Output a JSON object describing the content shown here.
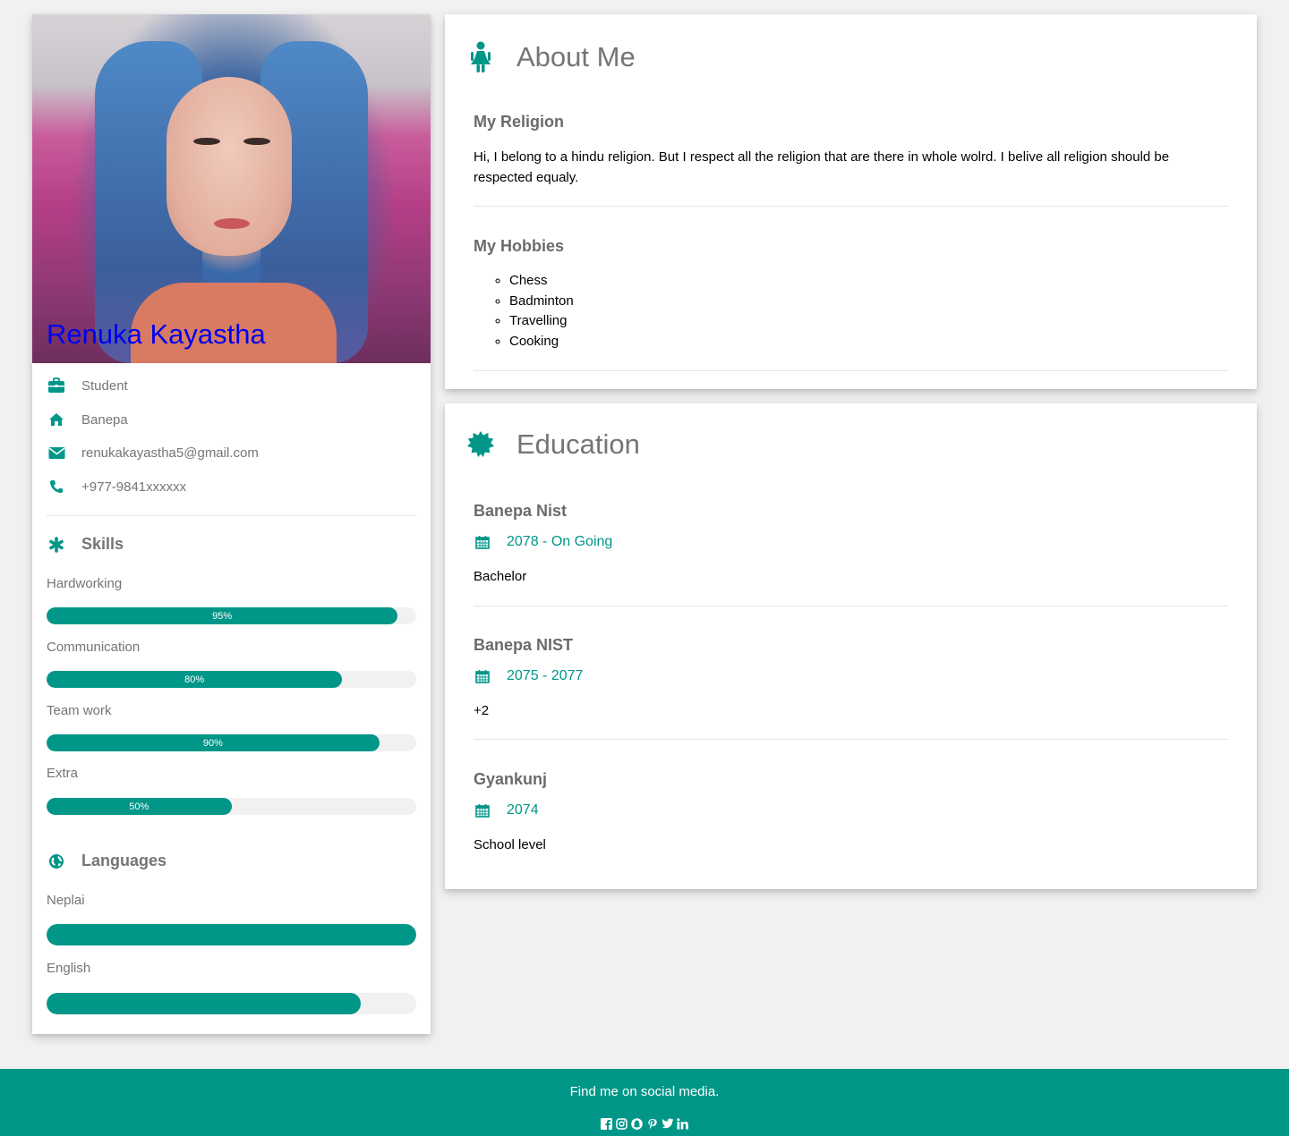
{
  "profile": {
    "name": "Renuka Kayastha",
    "job": "Student",
    "location": "Banepa",
    "email": "renukakayastha5@gmail.com",
    "phone": "+977-9841xxxxxx",
    "accent_color": "#009688",
    "name_color": "#0000ee"
  },
  "skills": {
    "title": "Skills",
    "items": [
      {
        "label": "Hardworking",
        "percent_text": "95%",
        "level": 95
      },
      {
        "label": "Communication",
        "percent_text": "80%",
        "level": 80
      },
      {
        "label": "Team work",
        "percent_text": "90%",
        "level": 90
      },
      {
        "label": "Extra",
        "percent_text": "50%",
        "level": 50
      }
    ]
  },
  "languages": {
    "title": "Languages",
    "items": [
      {
        "label": "Neplai",
        "level": 100
      },
      {
        "label": "English",
        "level": 85
      }
    ]
  },
  "about": {
    "title": "About Me",
    "religion_title": "My Religion",
    "religion_text": "Hi, I belong to a hindu religion. But I respect all the religion that are there in whole wolrd. I belive all religion should be respected equaly.",
    "hobbies_title": "My Hobbies",
    "hobbies": [
      "Chess",
      "Badminton",
      "Travelling",
      "Cooking"
    ]
  },
  "education": {
    "title": "Education",
    "entries": [
      {
        "school": "Banepa Nist",
        "dates": "2078 - On Going",
        "level": "Bachelor"
      },
      {
        "school": "Banepa NIST",
        "dates": "2075 - 2077",
        "level": "+2"
      },
      {
        "school": "Gyankunj",
        "dates": "2074",
        "level": "School level"
      }
    ]
  },
  "footer": {
    "text": "Find me on social media.",
    "icons": [
      "facebook-icon",
      "instagram-icon",
      "snapchat-icon",
      "pinterest-icon",
      "twitter-icon",
      "linkedin-icon"
    ]
  }
}
